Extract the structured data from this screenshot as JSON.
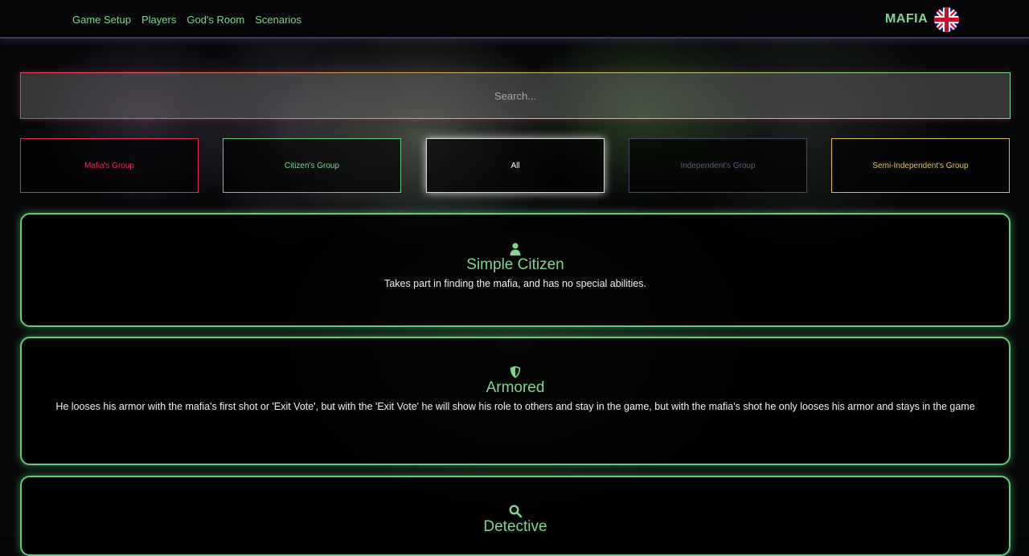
{
  "header": {
    "nav": [
      {
        "label": "Game Setup"
      },
      {
        "label": "Players"
      },
      {
        "label": "God's Room"
      },
      {
        "label": "Scenarios"
      }
    ],
    "brand": "MAFIA",
    "language_icon": "uk-flag-icon"
  },
  "search": {
    "placeholder": "Search..."
  },
  "filters": [
    {
      "label": "Mafia's Group",
      "color": "#e0314f"
    },
    {
      "label": "Citizen's Group",
      "color": "#7fd890"
    },
    {
      "label": "All",
      "color": "#ffffff",
      "active": true
    },
    {
      "label": "Independent's Group",
      "color": "#5b5e7a"
    },
    {
      "label": "Semi-Independent's Group",
      "color": "#e0c766"
    }
  ],
  "roles": [
    {
      "icon": "user-icon",
      "title": "Simple Citizen",
      "description": "Takes part in finding the mafia, and has no special abilities."
    },
    {
      "icon": "shield-icon",
      "title": "Armored",
      "description": "He looses his armor with the mafia's first shot or 'Exit Vote', but with the 'Exit Vote' he will show his role to others and stay in the game, but with the mafia's shot he only looses his armor and stays in the game"
    },
    {
      "icon": "magnifier-icon",
      "title": "Detective",
      "description": ""
    }
  ],
  "colors": {
    "accent": "#7fd890",
    "mafia": "#e0314f",
    "independent": "#5b5e7a",
    "semi_independent": "#e0c766"
  }
}
